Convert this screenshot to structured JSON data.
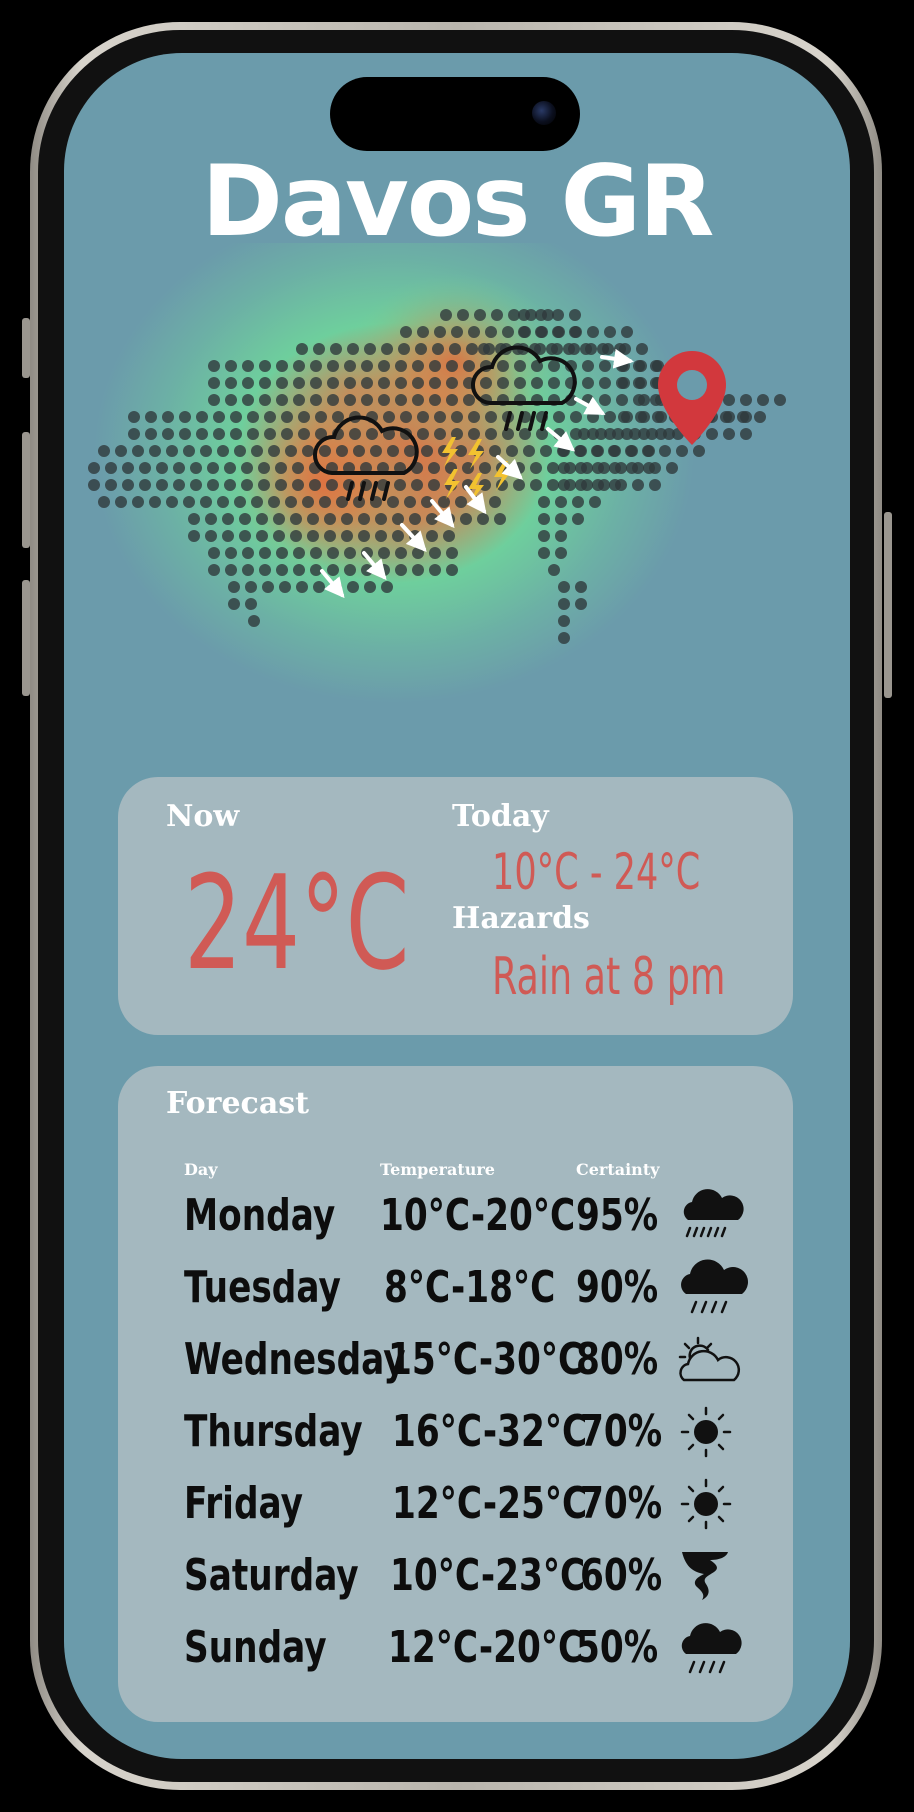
{
  "city": "Davos GR",
  "now": {
    "label": "Now",
    "temperature": "24°C"
  },
  "today": {
    "label": "Today",
    "range": "10°C - 24°C",
    "hazards_label": "Hazards",
    "hazard": "Rain at 8 pm"
  },
  "forecast": {
    "title": "Forecast",
    "headers": {
      "day": "Day",
      "temperature": "Temperature",
      "certainty": "Certainty"
    },
    "rows": [
      {
        "day": "Monday",
        "temp": "10°C-20°C",
        "certainty": "95%",
        "icon": "cloud-drizzle-icon"
      },
      {
        "day": "Tuesday",
        "temp": "8°C-18°C",
        "certainty": "90%",
        "icon": "cloud-rain-icon"
      },
      {
        "day": "Wednesday",
        "temp": "15°C-30°C",
        "certainty": "80%",
        "icon": "partly-cloudy-icon"
      },
      {
        "day": "Thursday",
        "temp": "16°C-32°C",
        "certainty": "70%",
        "icon": "sun-icon"
      },
      {
        "day": "Friday",
        "temp": "12°C-25°C",
        "certainty": "70%",
        "icon": "sun-icon"
      },
      {
        "day": "Saturday",
        "temp": "10°C-23°C",
        "certainty": "60%",
        "icon": "tornado-icon"
      },
      {
        "day": "Sunday",
        "temp": "12°C-20°C",
        "certainty": "50%",
        "icon": "cloud-rain-icon"
      }
    ]
  },
  "colors": {
    "screen_bg": "#6b9bab",
    "card_bg": "#a4b8bf",
    "accent_red": "#d05a55",
    "pin_red": "#d2383d",
    "heat_green": "#6fd89a",
    "heat_orange": "#e0703f",
    "lightning_yellow": "#f2c230"
  }
}
